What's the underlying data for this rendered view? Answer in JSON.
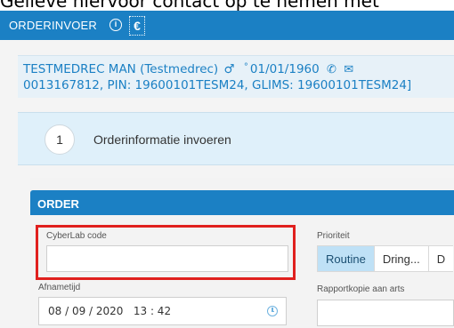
{
  "banner": {
    "text": "Gelieve hiervoor contact op te nemen met"
  },
  "appbar": {
    "title": "ORDERINVOER",
    "info_icon": "info-icon",
    "info_glyph": "i",
    "euro_icon": "euro-icon",
    "euro_glyph": "€",
    "color": "#1b80c4"
  },
  "patient": {
    "name": "TESTMEDREC MAN (Testmedrec)",
    "gender_glyph": "♂",
    "birth_prefix": "°",
    "birthdate": "01/01/1960",
    "phone_glyph": "✆",
    "mail_glyph": "✉",
    "identifiers": "0013167812, PIN: 19600101TESM24, GLIMS: 19600101TESM24]"
  },
  "wizard": {
    "step_number": "1",
    "step_label": "Orderinformatie invoeren"
  },
  "order": {
    "title": "ORDER",
    "cyberlab_label": "CyberLab code",
    "cyberlab_value": "",
    "priority_label": "Prioriteit",
    "priority_options": [
      "Routine",
      "Dring...",
      "D"
    ],
    "priority_selected": "Routine",
    "afnametijd_label": "Afnametijd",
    "afnametijd_value": "08 / 09 / 2020   13 : 42",
    "rapportkopie_label": "Rapportkopie aan arts",
    "rapportkopie_value": ""
  },
  "colors": {
    "accent": "#1b80c4",
    "highlight_box": "#e0201e",
    "selected_option": "#bfe1f6"
  }
}
